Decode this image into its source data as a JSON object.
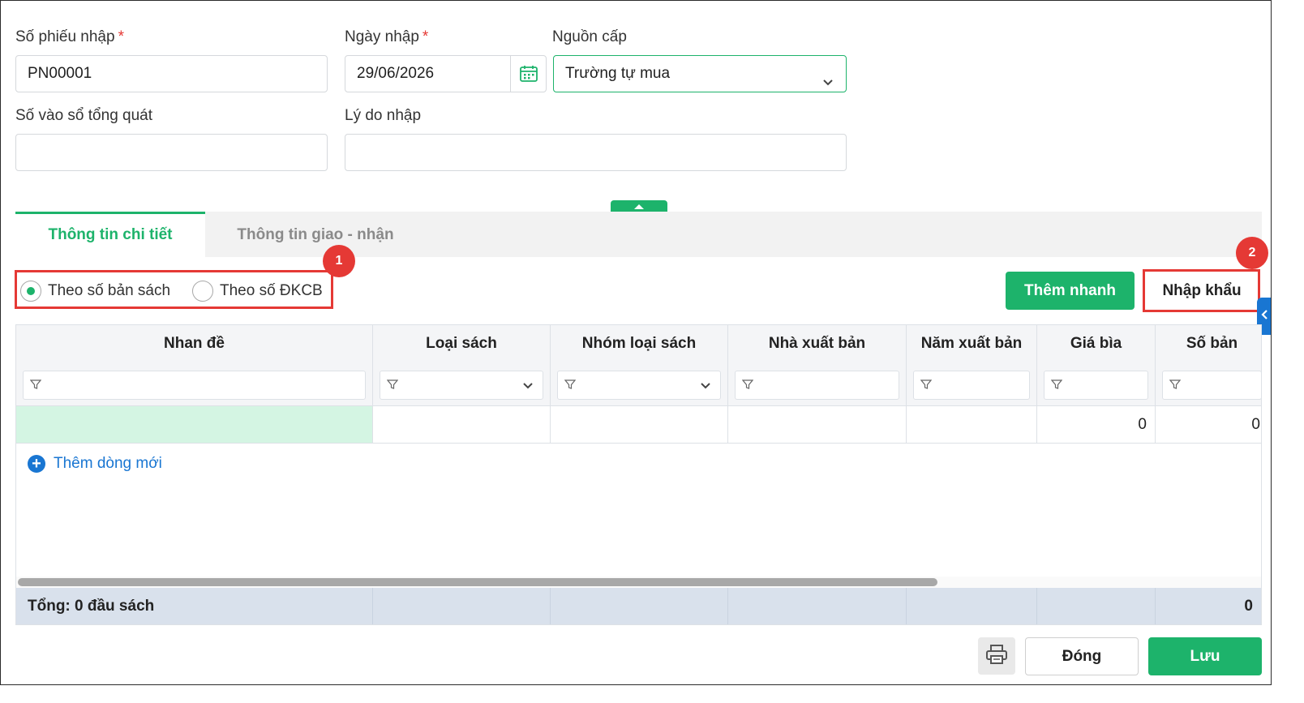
{
  "form": {
    "so_phieu_label": "Số phiếu nhập",
    "so_phieu_value": "PN00001",
    "ngay_nhap_label": "Ngày nhập",
    "ngay_nhap_value": "29/06/2026",
    "nguon_cap_label": "Nguồn cấp",
    "nguon_cap_value": "Trường tự mua",
    "so_vao_so_label": "Số vào sổ tổng quát",
    "so_vao_so_value": "",
    "ly_do_label": "Lý do nhập",
    "ly_do_value": "",
    "required_mark": "*"
  },
  "tabs": [
    {
      "label": "Thông tin chi tiết",
      "active": true
    },
    {
      "label": "Thông tin giao - nhận",
      "active": false
    }
  ],
  "radio_options": [
    {
      "label": "Theo số bản sách",
      "selected": true
    },
    {
      "label": "Theo số ĐKCB",
      "selected": false
    }
  ],
  "annotations": {
    "badge1": "1",
    "badge2": "2"
  },
  "actions": {
    "them_nhanh": "Thêm nhanh",
    "nhap_khau": "Nhập khẩu",
    "dong": "Đóng",
    "luu": "Lưu"
  },
  "grid": {
    "columns": [
      "Nhan đề",
      "Loại sách",
      "Nhóm loại sách",
      "Nhà xuất bản",
      "Năm xuất bản",
      "Giá bìa",
      "Số bản"
    ],
    "row": {
      "gia_bia": "0",
      "so_ban": "0"
    },
    "add_row": "Thêm dòng mới",
    "total_label": "Tổng: 0 đầu sách",
    "total_value": "0"
  },
  "icons": [
    "calendar-icon",
    "chevron-down-icon",
    "filter-icon",
    "plus-icon",
    "printer-icon",
    "collapse-up-icon",
    "chevron-left-icon"
  ],
  "colors": {
    "primary": "#1db36b",
    "accent_blue": "#1976d2",
    "annotation_red": "#e53935",
    "row_highlight": "#d4f5e3",
    "footer": "#d9e1ec"
  }
}
